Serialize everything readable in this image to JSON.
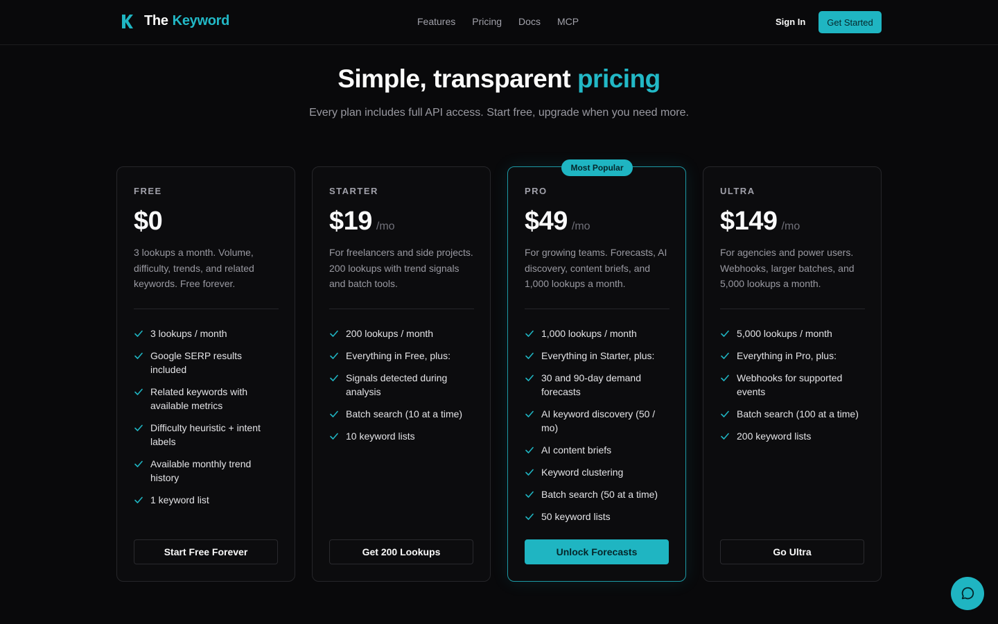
{
  "nav": {
    "brand_first": "The",
    "brand_second": "Keyword",
    "links": [
      "Features",
      "Pricing",
      "Docs",
      "MCP"
    ],
    "sign_in": "Sign In",
    "get_started": "Get Started"
  },
  "hero": {
    "title_main": "Simple, transparent",
    "title_accent": "pricing",
    "subtitle": "Every plan includes full API access. Start free, upgrade when you need more."
  },
  "colors": {
    "accent": "#1fb5c2",
    "background": "#09090b",
    "card_border": "#26262a"
  },
  "plans": [
    {
      "tier": "FREE",
      "price": "$0",
      "period": "",
      "description": "3 lookups a month. Volume, difficulty, trends, and related keywords. Free forever.",
      "features": [
        "3 lookups / month",
        "Google SERP results included",
        "Related keywords with available metrics",
        "Difficulty heuristic + intent labels",
        "Available monthly trend history",
        "1 keyword list"
      ],
      "cta": "Start Free Forever",
      "badge": ""
    },
    {
      "tier": "STARTER",
      "price": "$19",
      "period": "/mo",
      "description": "For freelancers and side projects. 200 lookups with trend signals and batch tools.",
      "features": [
        "200 lookups / month",
        "Everything in Free, plus:",
        "Signals detected during analysis",
        "Batch search (10 at a time)",
        "10 keyword lists"
      ],
      "cta": "Get 200 Lookups",
      "badge": ""
    },
    {
      "tier": "PRO",
      "price": "$49",
      "period": "/mo",
      "description": "For growing teams. Forecasts, AI discovery, content briefs, and 1,000 lookups a month.",
      "features": [
        "1,000 lookups / month",
        "Everything in Starter, plus:",
        "30 and 90-day demand forecasts",
        "AI keyword discovery (50 / mo)",
        "AI content briefs",
        "Keyword clustering",
        "Batch search (50 at a time)",
        "50 keyword lists"
      ],
      "cta": "Unlock Forecasts",
      "badge": "Most Popular"
    },
    {
      "tier": "ULTRA",
      "price": "$149",
      "period": "/mo",
      "description": "For agencies and power users. Webhooks, larger batches, and 5,000 lookups a month.",
      "features": [
        "5,000 lookups / month",
        "Everything in Pro, plus:",
        "Webhooks for supported events",
        "Batch search (100 at a time)",
        "200 keyword lists"
      ],
      "cta": "Go Ultra",
      "badge": ""
    }
  ],
  "chat": {
    "icon": "chat-bubble-icon"
  }
}
